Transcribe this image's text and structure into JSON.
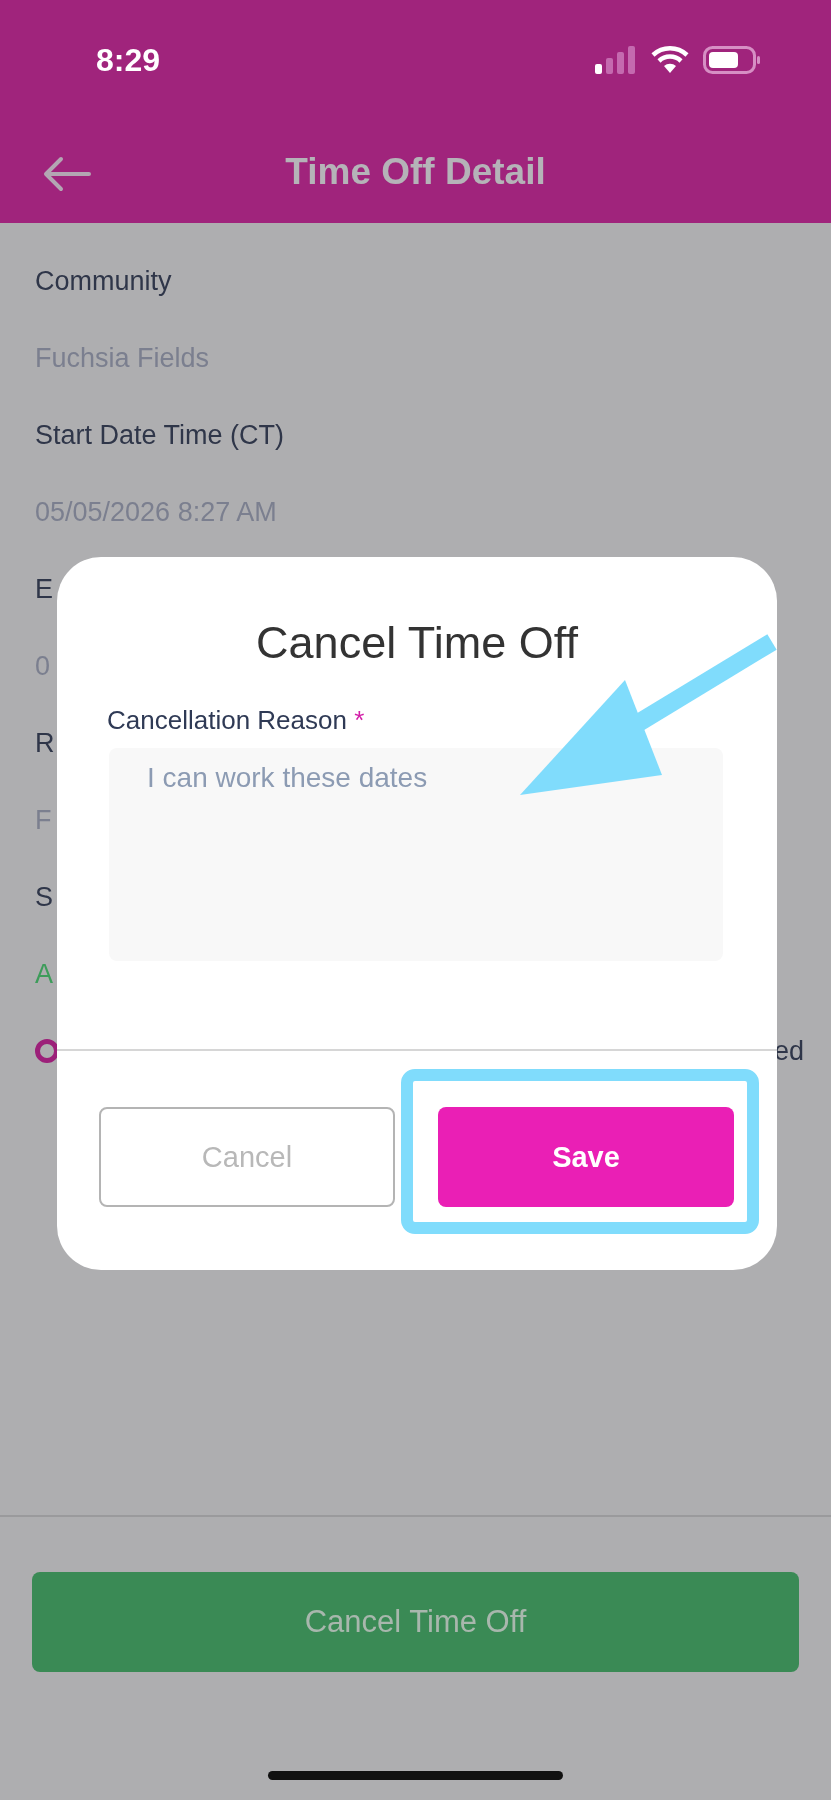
{
  "status_bar": {
    "time": "8:29"
  },
  "header": {
    "title": "Time Off Detail"
  },
  "details": [
    {
      "kind": "label",
      "text": "Community"
    },
    {
      "kind": "value",
      "text": "Fuchsia Fields"
    },
    {
      "kind": "label",
      "text": "Start Date Time (CT)"
    },
    {
      "kind": "value",
      "text": "05/05/2026 8:27 AM"
    },
    {
      "kind": "label",
      "text": "E"
    },
    {
      "kind": "value",
      "text": "0"
    },
    {
      "kind": "label",
      "text": "R"
    },
    {
      "kind": "value",
      "text": "F"
    },
    {
      "kind": "label",
      "text": "S"
    },
    {
      "kind": "status",
      "text": "A"
    },
    {
      "kind": "option",
      "text": "ed"
    }
  ],
  "footer": {
    "button": "Cancel Time Off"
  },
  "dialog": {
    "title": "Cancel Time Off",
    "field_label": "Cancellation Reason",
    "required_mark": "*",
    "placeholder": "I can work these dates",
    "buttons": [
      {
        "label": "Cancel",
        "kind": "secondary"
      },
      {
        "label": "Save",
        "kind": "primary",
        "highlighted": true
      }
    ]
  }
}
